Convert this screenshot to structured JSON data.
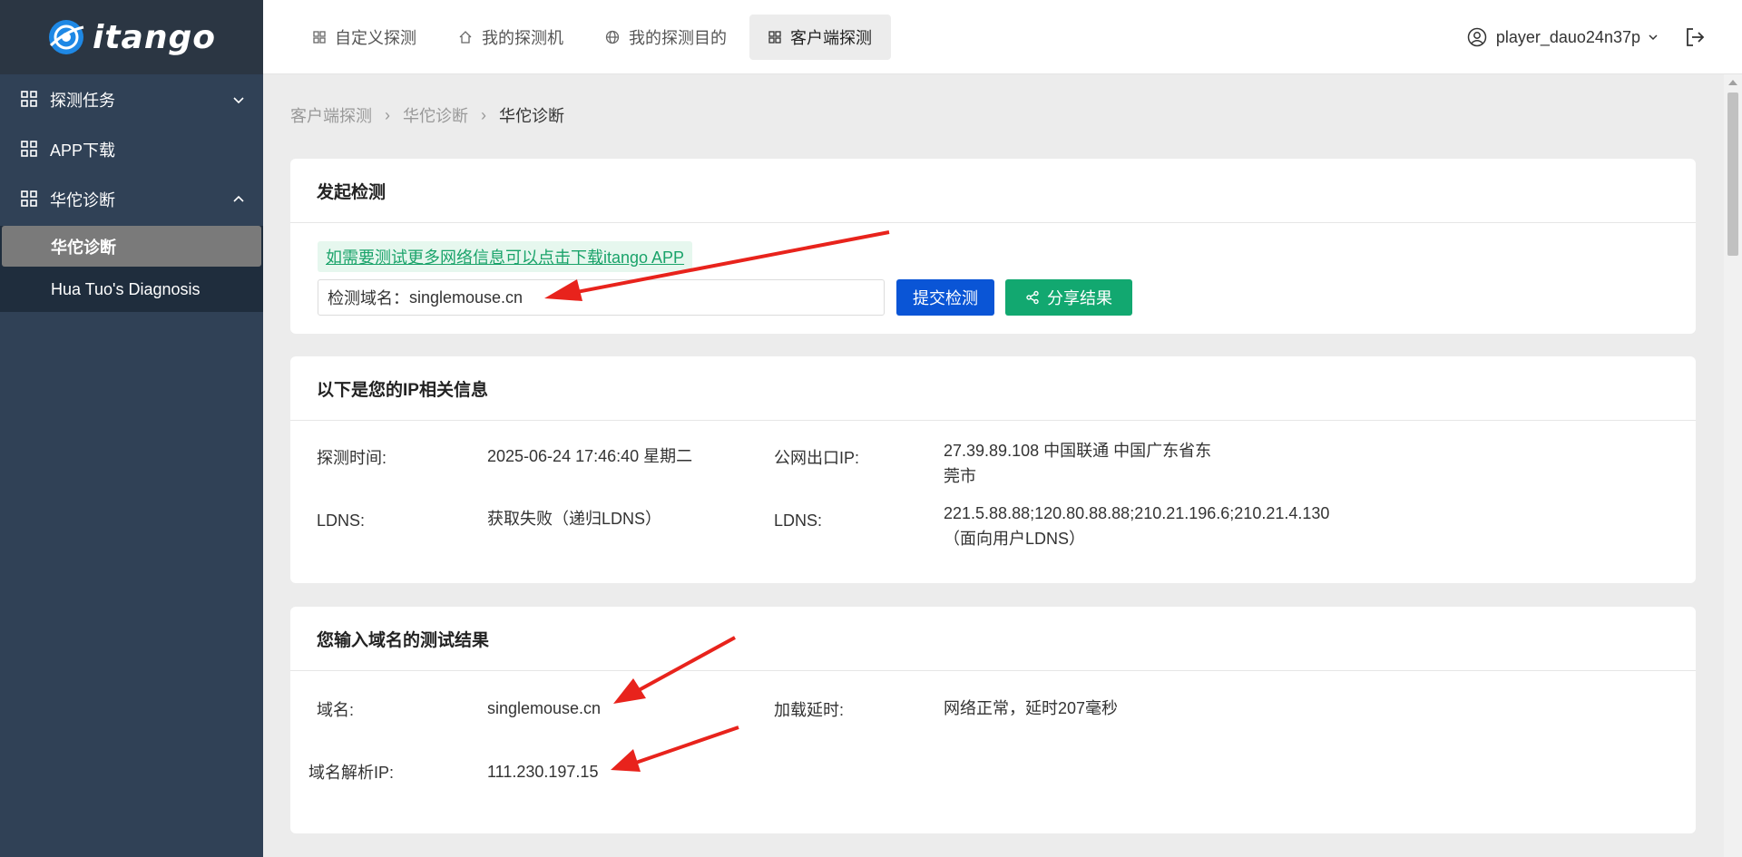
{
  "app": {
    "logo_text": "itango"
  },
  "sidebar": {
    "items": [
      {
        "label": "探测任务"
      },
      {
        "label": "APP下载"
      },
      {
        "label": "华佗诊断"
      }
    ],
    "submenu": [
      {
        "label": "华佗诊断"
      },
      {
        "label": "Hua Tuo's Diagnosis"
      }
    ]
  },
  "header": {
    "tabs": [
      {
        "label": "自定义探测"
      },
      {
        "label": "我的探测机"
      },
      {
        "label": "我的探测目的"
      },
      {
        "label": "客户端探测"
      }
    ],
    "username": "player_dauo24n37p"
  },
  "breadcrumb": [
    "客户端探测",
    "华佗诊断",
    "华佗诊断"
  ],
  "detect_card": {
    "title": "发起检测",
    "tip": "如需要测试更多网络信息可以点击下载itango APP",
    "input_label": "检测域名：",
    "input_value": "singlemouse.cn",
    "submit_label": "提交检测",
    "share_label": "分享结果"
  },
  "ip_card": {
    "title": "以下是您的IP相关信息",
    "probe_time_label": "探测时间:",
    "probe_time_value": "2025-06-24 17:46:40 星期二",
    "public_ip_label": "公网出口IP:",
    "public_ip_value_line1": "27.39.89.108 中国联通 中国广东省东",
    "public_ip_value_line2": "莞市",
    "ldns_label": "LDNS:",
    "ldns_value": "获取失败（递归LDNS）",
    "ldns2_label": "LDNS:",
    "ldns2_value_line1": "221.5.88.88;120.80.88.88;210.21.196.6;210.21.4.130",
    "ldns2_value_line2": "（面向用户LDNS）"
  },
  "result_card": {
    "title": "您输入域名的测试结果",
    "domain_label": "域名:",
    "domain_value": "singlemouse.cn",
    "latency_label": "加载延时:",
    "latency_value": "网络正常，延时207毫秒",
    "resolved_ip_label": "域名解析IP:",
    "resolved_ip_value": "111.230.197.15"
  },
  "colors": {
    "sidebar_bg": "#304156",
    "submit_button": "#0a55d6",
    "share_button": "#12a870",
    "annotation_arrow": "#e8231c"
  }
}
